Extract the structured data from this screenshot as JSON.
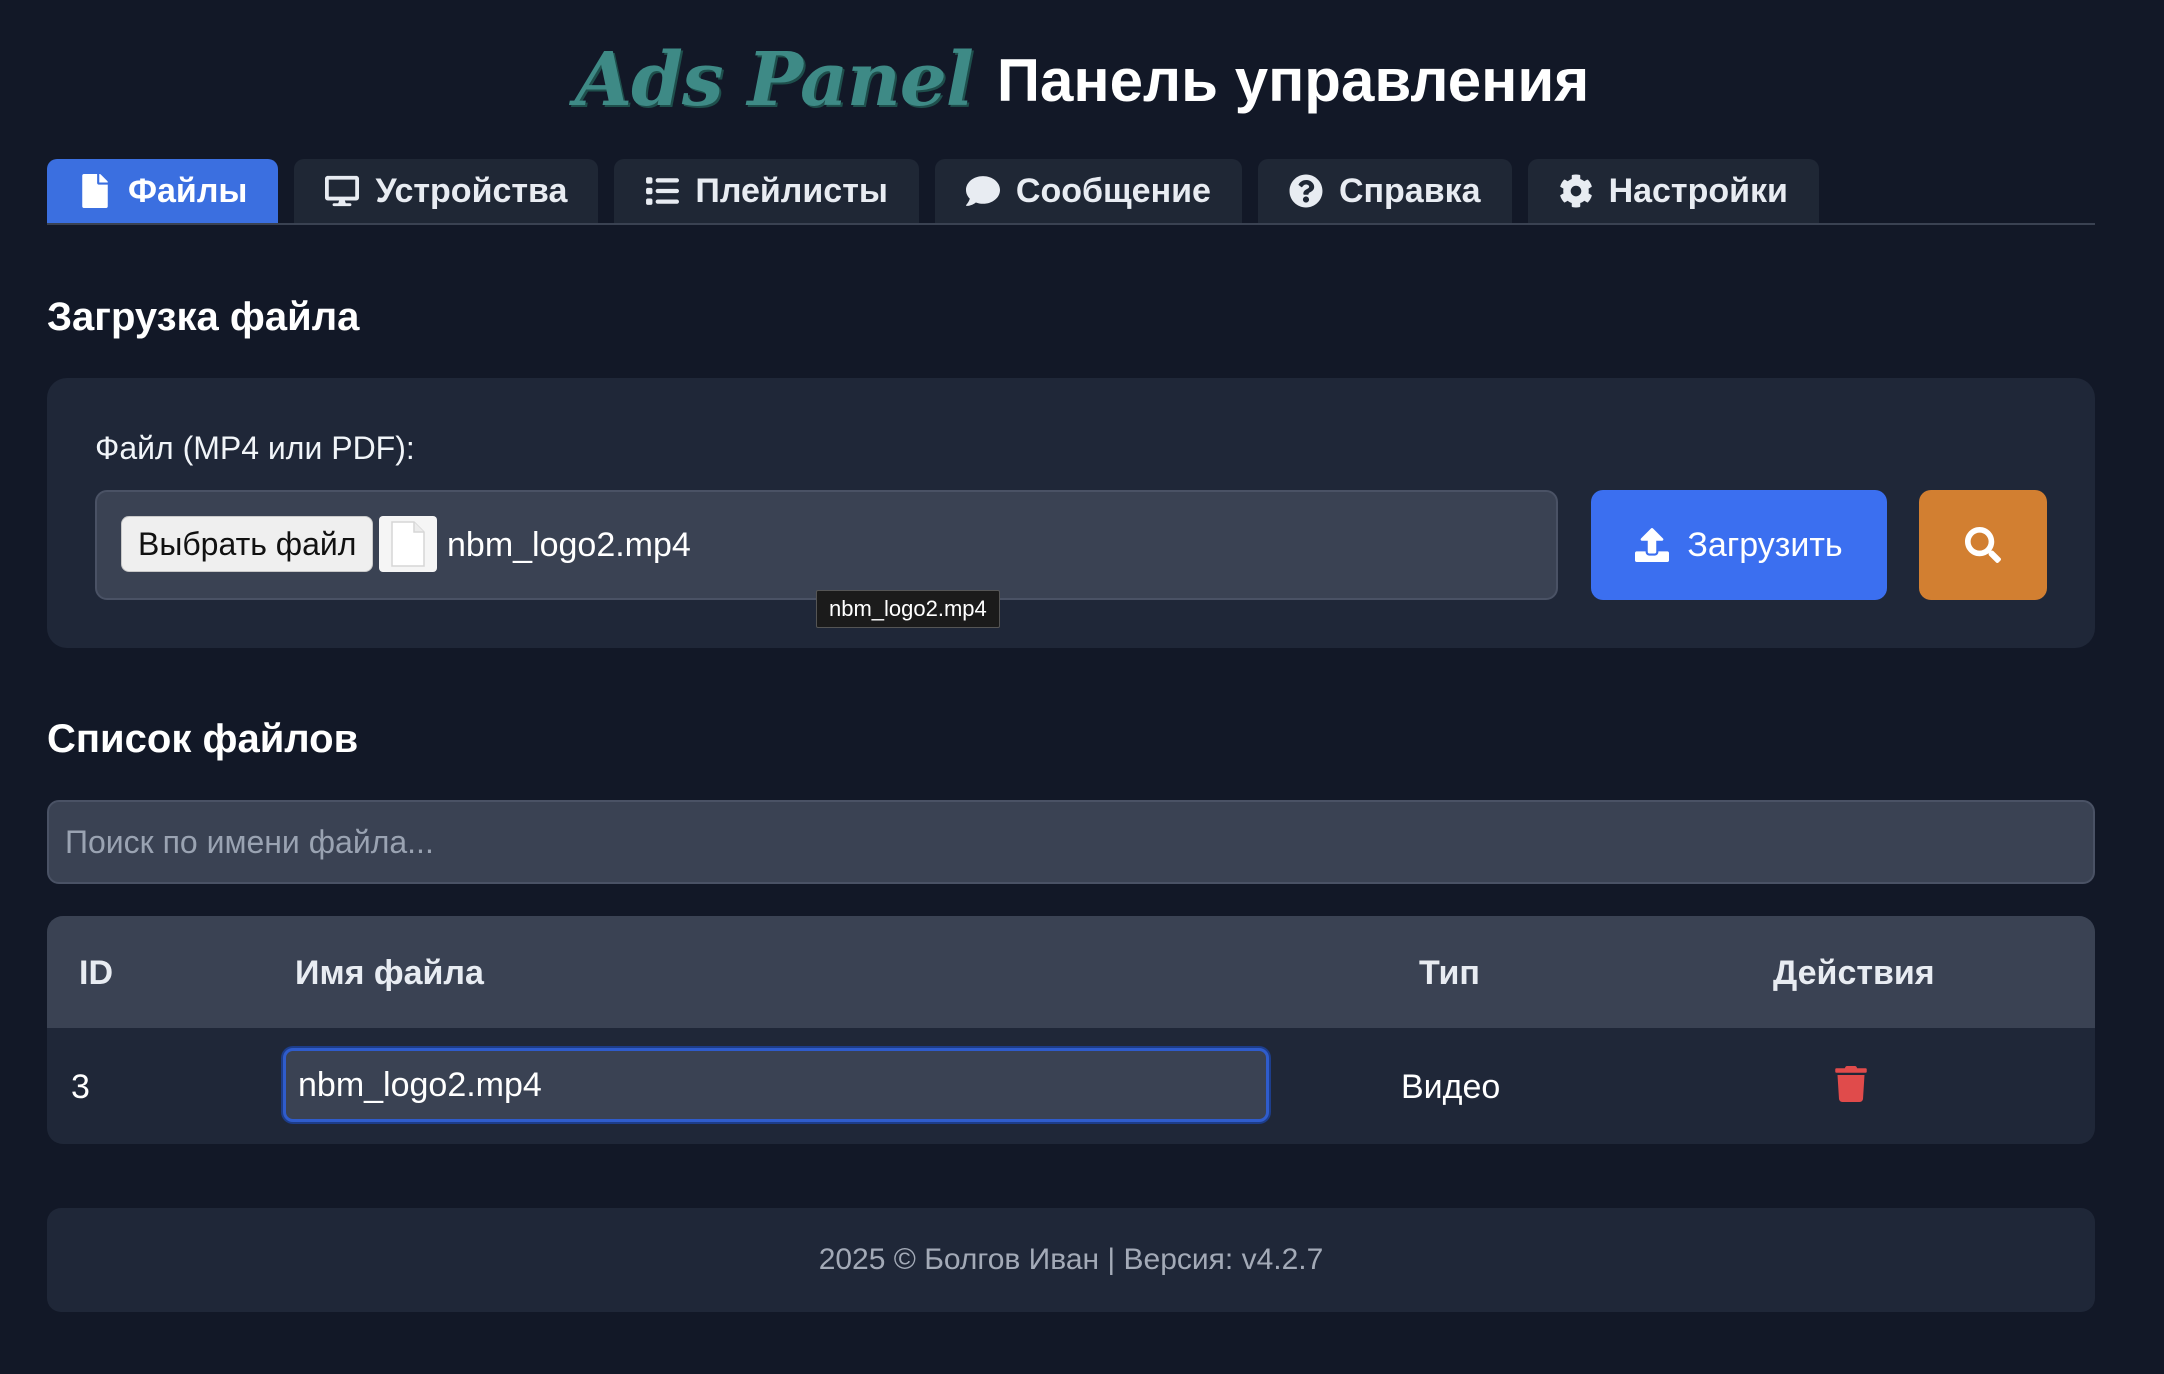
{
  "header": {
    "logo": "Ads Panel",
    "title": "Панель управления"
  },
  "tabs": [
    {
      "label": "Файлы",
      "icon": "file-icon",
      "active": true
    },
    {
      "label": "Устройства",
      "icon": "desktop-icon",
      "active": false
    },
    {
      "label": "Плейлисты",
      "icon": "list-icon",
      "active": false
    },
    {
      "label": "Сообщение",
      "icon": "comment-icon",
      "active": false
    },
    {
      "label": "Справка",
      "icon": "question-circle-icon",
      "active": false
    },
    {
      "label": "Настройки",
      "icon": "gear-icon",
      "active": false
    }
  ],
  "upload": {
    "section_title": "Загрузка файла",
    "label": "Файл (MP4 или PDF):",
    "choose_button": "Выбрать файл",
    "selected_file": "nbm_logo2.mp4",
    "tooltip": "nbm_logo2.mp4",
    "upload_button": "Загрузить",
    "upload_icon": "upload-icon",
    "search_icon": "search-icon"
  },
  "files": {
    "section_title": "Список файлов",
    "search_placeholder": "Поиск по имени файла...",
    "columns": [
      "ID",
      "Имя файла",
      "Тип",
      "Действия"
    ],
    "rows": [
      {
        "id": "3",
        "name": "nbm_logo2.mp4",
        "type": "Видео",
        "action_icon": "trash-icon"
      }
    ]
  },
  "footer": {
    "text": "2025 © Болгов Иван | Версия: v4.2.7"
  },
  "colors": {
    "background": "#121827",
    "card": "#1f2738",
    "input": "#3a4253",
    "accent_blue": "#3b6ff0",
    "accent_orange": "#d27f31",
    "danger": "#e04b4b",
    "logo": "#3e8a86"
  }
}
